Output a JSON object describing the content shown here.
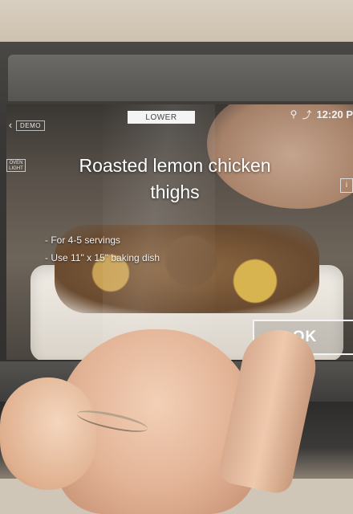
{
  "screen": {
    "back_icon": "back-arrow-icon",
    "demo_label": "DEMO",
    "oven_tab": "LOWER",
    "status": {
      "remote_icon": "remote-control-icon",
      "wifi_icon": "wifi-icon",
      "time": "12:20 P"
    },
    "oven_light_label": "OVEN LIGHT",
    "info_icon": "info-icon",
    "recipe": {
      "title": "Roasted lemon chicken thighs",
      "notes": [
        "For 4-5 servings",
        "Use 11\" x 15\" baking dish"
      ]
    },
    "ok_label": "OK"
  }
}
